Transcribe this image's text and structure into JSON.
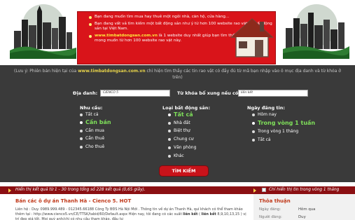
{
  "banner": {
    "items": [
      {
        "text": "Bạn đang muốn tìm mua hay thuê một ngôi nhà, căn hộ, cửa hàng...",
        "highlight": ""
      },
      {
        "text": "Bạn đang vất vả tìm kiếm một bất động sản như ý từ hơn 100 website rao vặt về bất động sản tại Việt Nam.",
        "highlight": ""
      },
      {
        "text": " là 1 website duy nhất giúp bạn tìm thấy bất động sản mong muốn từ hơn 100 website rao vặt này.",
        "highlight": "www.timbatdongsan.com.vn"
      }
    ]
  },
  "note": {
    "before": "(Lưu ý: Phiên bản hiện tại của ",
    "site": "www.timbatdongsan.com.vn",
    "after": " chỉ hiện tìm thấy các tin rao vặt có đầy đủ từ mã bạn nhập vào ô mục địa danh và từ khóa ở trên)"
  },
  "search": {
    "location_label": "Địa danh:",
    "location_value": "CIENCO 5",
    "keyword_label": "Từ khóa bổ xung nếu có:",
    "keyword_value": "liên kết",
    "submit_label": "TÌM KIẾM"
  },
  "filters": {
    "need": {
      "heading": "Nhu cầu:",
      "options": [
        "Tất cả",
        "Cần bán",
        "Cần mua",
        "Cần thuê",
        "Cho thuê"
      ],
      "selected": 1
    },
    "type": {
      "heading": "Loại bất động sản:",
      "options": [
        "Tất cả",
        "Nhà đất",
        "Biệt thự",
        "Chung cư",
        "Văn phòng",
        "Khác"
      ],
      "selected": 0
    },
    "date": {
      "heading": "Ngày đăng tin:",
      "options": [
        "Hôm nay",
        "Trong vòng 1 tuần",
        "Trong vòng 1 tháng",
        "Tất cả"
      ],
      "selected": 1
    }
  },
  "results": {
    "summary": "Hiển thị kết quả từ  1  - 30  trong tổng số 228 kết quả (0,65 giây).",
    "recent_label": "Chỉ hiển thị tin trong vòng 1 tháng"
  },
  "listing": {
    "title": "Bán các ô dự án Thanh Hà - Cienco 5. HOT",
    "desc_1": "Liên hệ : Duy. 0989.999.489 - 012345.66188 Công Ty BĐS Hà Nội Mới . Thông tin về dự án Thanh Hà, quí khách có thể tham khảo thêm tại : http://www.cienco5.vn/CE/TTSK/tabid/60/Default.aspx Hiện nay, tôi đang có các suất ",
    "desc_bold_1": "liên kết",
    "desc_mid": " ( ",
    "desc_bold_2": "liên kết",
    "desc_2": " 8,9,10,13,15 ) vị trí đẹp giá tốt. Mọi quý anh/chị có nhu cầu tham khảo, đầu tư"
  },
  "sidebar": {
    "title": "Thỏa thuận",
    "date_label": "Ngày đăng:",
    "date_value": "Hôm qua",
    "poster_label": "Người đăng:",
    "poster_value": "Duy"
  },
  "colors": {
    "banner_red": "#d9141a",
    "dark_bg": "#3a3a3a",
    "selected_green": "#7fe05a",
    "results_bar": "#8b0f12",
    "title_red": "#c0391a"
  }
}
